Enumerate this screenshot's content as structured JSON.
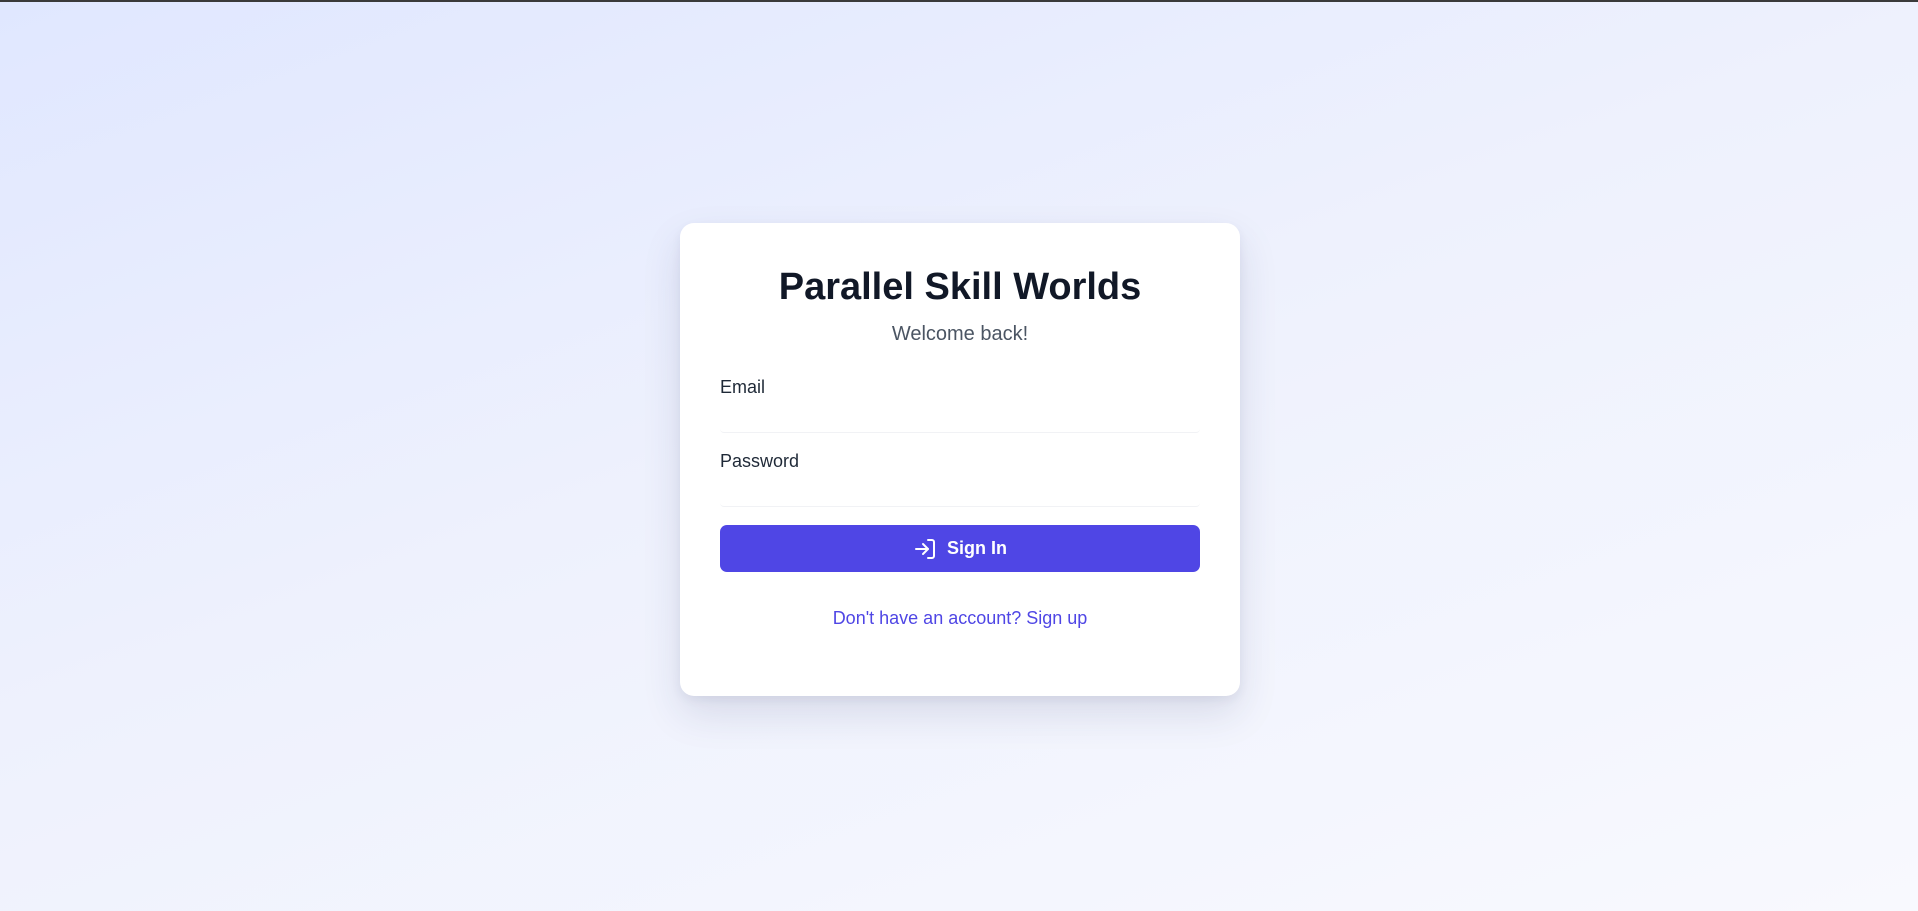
{
  "app": {
    "title": "Parallel Skill Worlds",
    "subtitle": "Welcome back!"
  },
  "form": {
    "email_label": "Email",
    "email_value": "",
    "email_placeholder": "",
    "password_label": "Password",
    "password_value": "",
    "password_placeholder": "",
    "submit_label": "Sign In",
    "submit_icon": "sign-in-icon",
    "signup_link": "Don't have an account? Sign up"
  },
  "colors": {
    "accent": "#4f46e5",
    "title": "#111827",
    "subtitle": "#4b5563"
  }
}
